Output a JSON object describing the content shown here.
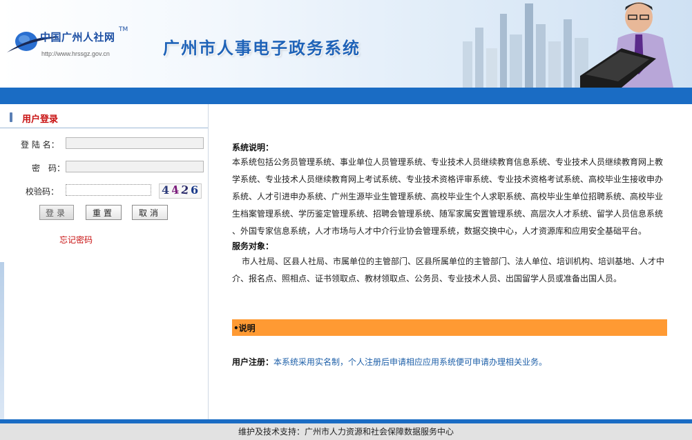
{
  "header": {
    "logo_name": "中国广州人社网",
    "logo_tm": "TM",
    "logo_url": "http://www.hrssgz.gov.cn",
    "system_title": "广州市人事电子政务系统"
  },
  "login": {
    "panel_title": "用户登录",
    "username_label": "登 陆 名：",
    "username_value": "",
    "password_label": "密　码：",
    "password_value": "",
    "captcha_label": "校验码：",
    "captcha_value": "",
    "captcha_chars": [
      "4",
      "4",
      "2",
      "6"
    ],
    "login_button": "登录",
    "reset_button": "重置",
    "cancel_button": "取消",
    "forgot_link": "忘记密码"
  },
  "content": {
    "desc_title": "系统说明：",
    "desc_text": "本系统包括公务员管理系统、事业单位人员管理系统、专业技术人员继续教育信息系统、专业技术人员继续教育网上教学系统、专业技术人员继续教育网上考试系统、专业技术资格评审系统、专业技术资格考试系统、高校毕业生接收申办系统、人才引进申办系统、广州生源毕业生管理系统、高校毕业生个人求职系统、高校毕业生单位招聘系统、高校毕业生档案管理系统、学历鉴定管理系统、招聘会管理系统、随军家属安置管理系统、高层次人才系统、留学人员信息系统 、外国专家信息系统，人才市场与人才中介行业协会管理系统，数据交换中心，人才资源库和应用安全基础平台。",
    "service_title": "服务对象：",
    "service_text": "市人社局、区县人社局、市属单位的主管部门、区县所属单位的主管部门、法人单位、培训机构、培训基地、人才中介、报名点、照相点、证书领取点、教材领取点、公务员、专业技术人员、出国留学人员或准备出国人员。",
    "notice_title": "•说明",
    "register_label": "用户注册：",
    "register_text": "本系统采用实名制，个人注册后申请相应应用系统便可申请办理相关业务。"
  },
  "footer": {
    "text": "维护及技术支持：广州市人力资源和社会保障数据服务中心"
  },
  "colors": {
    "primary_blue": "#1a6cc4",
    "title_blue": "#1f63b8",
    "accent_red": "#c81010",
    "notice_orange": "#ff9a33"
  }
}
